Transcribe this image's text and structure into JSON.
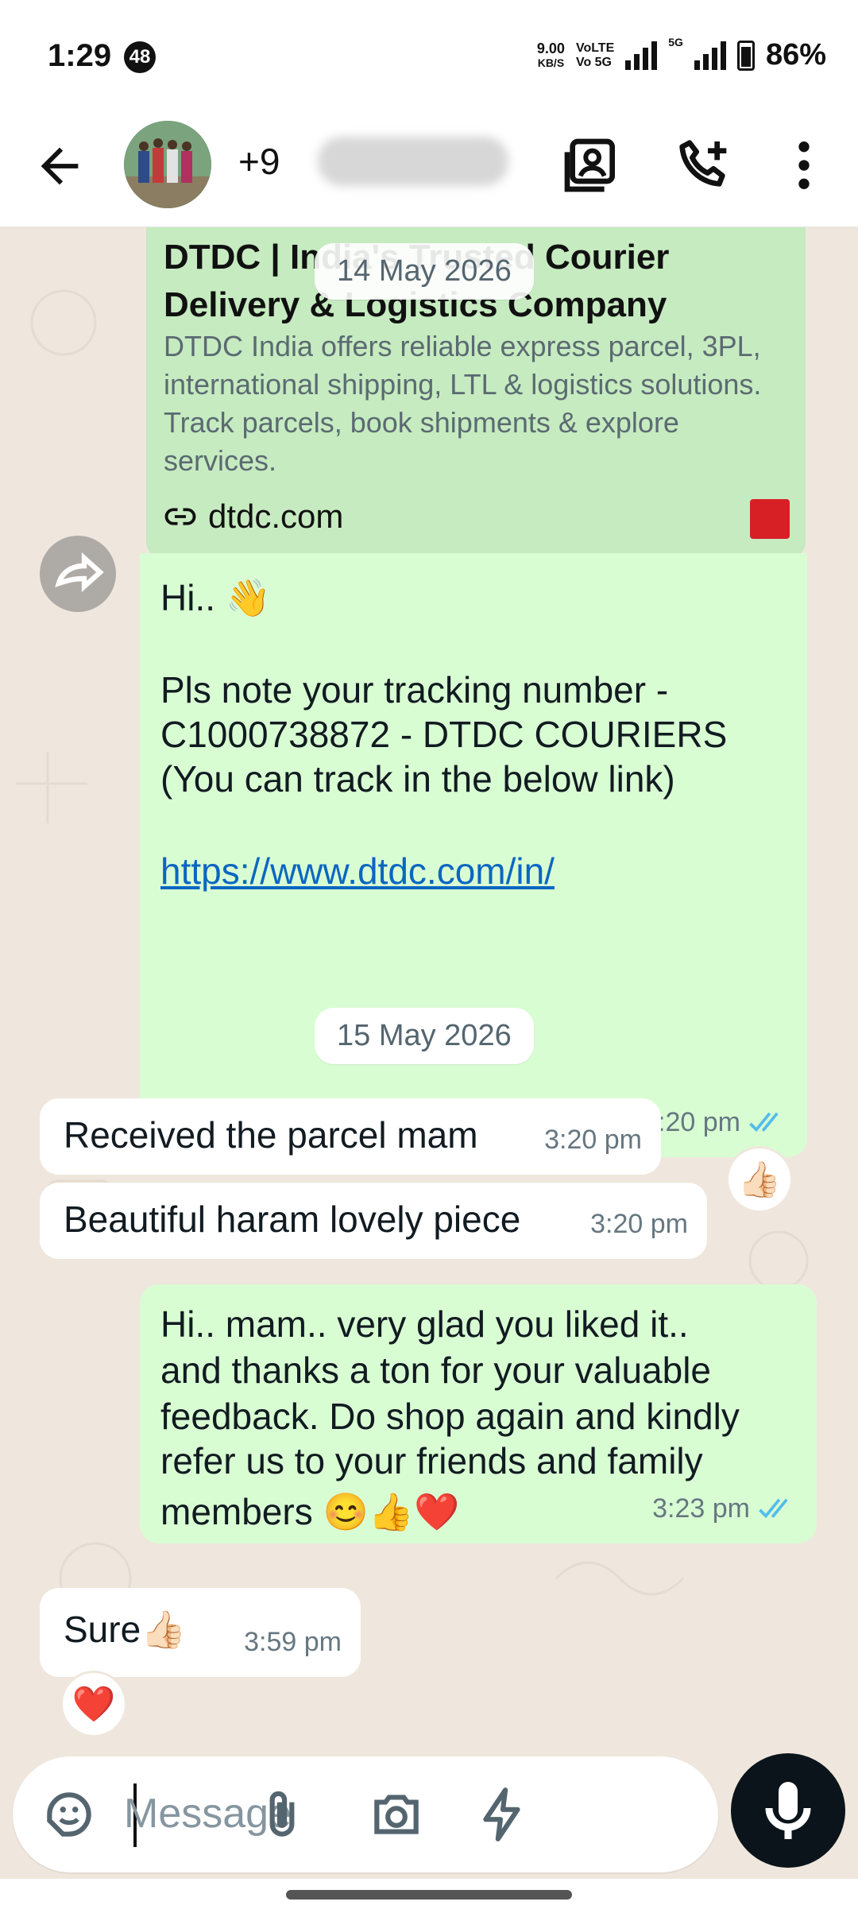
{
  "status_bar": {
    "time": "1:29",
    "notification_count": "48",
    "net_speed": "9.00",
    "net_unit": "KB/S",
    "volte_line1": "VoLTE",
    "volte_line2": "Vo 5G",
    "network_type": "5G",
    "battery": "86%"
  },
  "header": {
    "contact_name_visible": "+9"
  },
  "link_preview": {
    "title": "DTDC | India's Trusted Courier Delivery & Logistics Company",
    "description": "DTDC India offers reliable express parcel, 3PL, international shipping, LTL & logistics solutions. Track parcels, book shipments & explore services.",
    "domain": "dtdc.com"
  },
  "date_chips": {
    "first": "14 May 2026",
    "second": "15 May 2026"
  },
  "messages": [
    {
      "direction": "out",
      "line1": "Hi.. 👋",
      "line2": "Pls note your tracking number -",
      "line3": "C1000738872 - DTDC COURIERS",
      "line4": "(You can track in the below link)",
      "link": "https://www.dtdc.com/in/",
      "time": "12:20 pm",
      "reaction": "👍🏻"
    },
    {
      "direction": "in",
      "text": "Received the parcel mam",
      "time": "3:20 pm"
    },
    {
      "direction": "in",
      "text": "Beautiful haram lovely piece",
      "time": "3:20 pm"
    },
    {
      "direction": "out",
      "line1": "Hi.. mam.. very glad you liked it..",
      "line2": "and thanks a ton for your valuable",
      "line3": "feedback. Do shop again and kindly",
      "line4": "refer us to your friends and family",
      "line5": "members 😊👍❤️",
      "time": "3:23 pm"
    },
    {
      "direction": "in",
      "text": "Sure👍🏻",
      "time": "3:59 pm",
      "reaction": "❤️"
    }
  ],
  "composer": {
    "placeholder": "Message"
  },
  "colors": {
    "outgoing_bubble": "#d9fdd3",
    "incoming_bubble": "#ffffff",
    "read_ticks": "#53bdeb",
    "link": "#0b66c2"
  },
  "icons": [
    "back-arrow-icon",
    "video-call-icon",
    "add-call-icon",
    "more-options-icon",
    "forward-icon",
    "link-icon",
    "sticker-icon",
    "attach-icon",
    "camera-icon",
    "quick-reply-icon",
    "mic-icon"
  ]
}
